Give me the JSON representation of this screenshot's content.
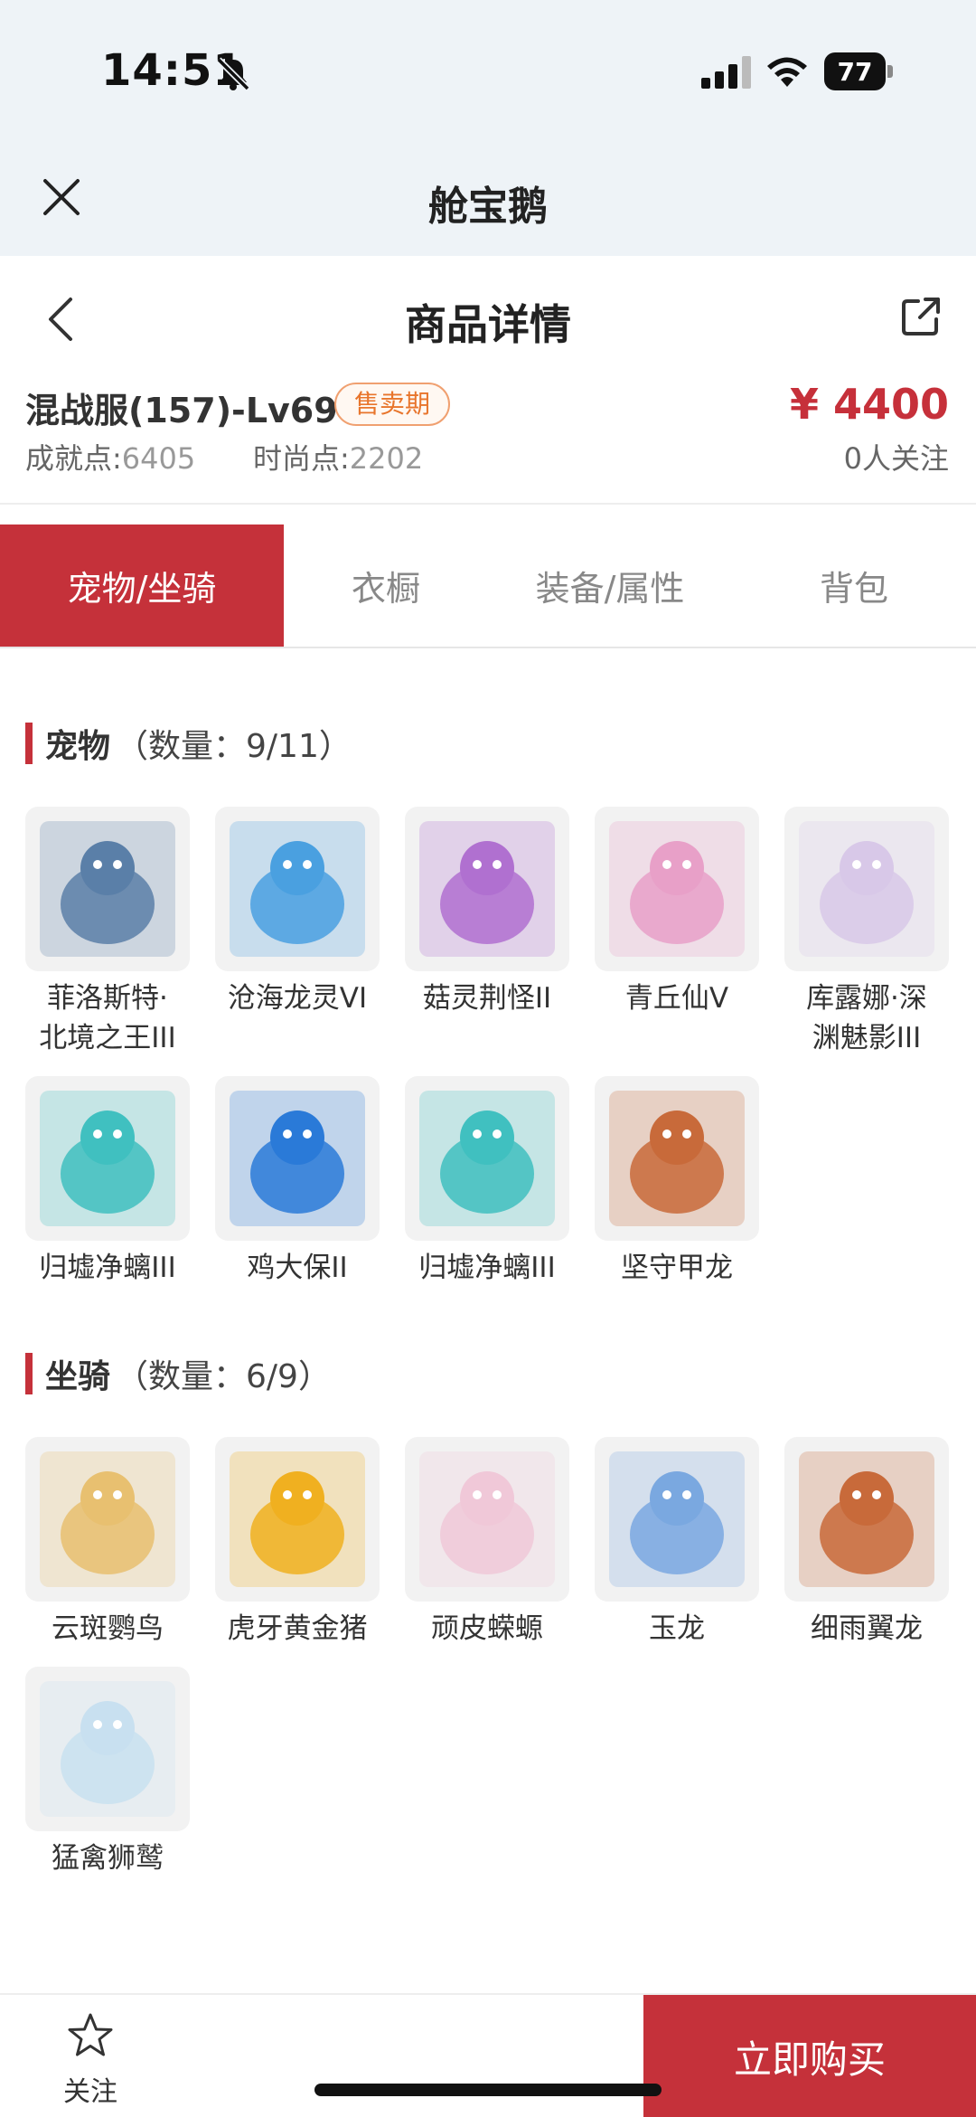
{
  "status_bar": {
    "time": "14:51",
    "battery": "77"
  },
  "app_bar": {
    "title": "舱宝鹅"
  },
  "header": {
    "title": "商品详情"
  },
  "product": {
    "name": "混战服(157)-Lv69",
    "status_badge": "售卖期",
    "price": "¥ 4400",
    "achievements_label": "成就点:",
    "achievements_value": "6405",
    "fashion_label": "时尚点:",
    "fashion_value": "2202",
    "followers": "0人关注"
  },
  "tabs": [
    {
      "label": "宠物/坐骑",
      "active": true
    },
    {
      "label": "衣橱",
      "active": false
    },
    {
      "label": "装备/属性",
      "active": false
    },
    {
      "label": "背包",
      "active": false
    }
  ],
  "pets": {
    "title": "宠物",
    "count": "（数量：9/11）",
    "items": [
      {
        "name": "菲洛斯特·北境之王III",
        "line1": "菲洛斯特·",
        "line2": "北境之王III",
        "icon": "white-wolf-king-icon",
        "color": "#5a7fa8"
      },
      {
        "name": "沧海龙灵VI",
        "line1": "沧海龙灵VI",
        "line2": "",
        "icon": "blue-dragon-spirit-icon",
        "color": "#4aa0e0"
      },
      {
        "name": "菇灵荆怪II",
        "line1": "菇灵荆怪II",
        "line2": "",
        "icon": "mushroom-sprite-icon",
        "color": "#b070d0"
      },
      {
        "name": "青丘仙V",
        "line1": "青丘仙V",
        "line2": "",
        "icon": "fox-fairy-icon",
        "color": "#e8a0c8"
      },
      {
        "name": "库露娜·深渊魅影III",
        "line1": "库露娜·深",
        "line2": "渊魅影III",
        "icon": "abyss-phantom-icon",
        "color": "#d8c8e8"
      },
      {
        "name": "归墟净螭III",
        "line1": "归墟净螭III",
        "line2": "",
        "icon": "water-dragon-icon",
        "color": "#40c0c0"
      },
      {
        "name": "鸡大保II",
        "line1": "鸡大保II",
        "line2": "",
        "icon": "blue-chicken-icon",
        "color": "#2a7ad8"
      },
      {
        "name": "归墟净螭III",
        "line1": "归墟净螭III",
        "line2": "",
        "icon": "water-dragon-icon",
        "color": "#40c0c0"
      },
      {
        "name": "坚守甲龙",
        "line1": "坚守甲龙",
        "line2": "",
        "icon": "armored-dragon-icon",
        "color": "#c86a3a"
      }
    ]
  },
  "mounts": {
    "title": "坐骑",
    "count": "（数量：6/9）",
    "items": [
      {
        "name": "云斑鹦鸟",
        "icon": "cloud-parrot-icon",
        "color": "#e8c070"
      },
      {
        "name": "虎牙黄金猪",
        "icon": "golden-pig-icon",
        "color": "#f0b020"
      },
      {
        "name": "顽皮蝾螈",
        "icon": "pink-axolotl-icon",
        "color": "#f0c8d8"
      },
      {
        "name": "玉龙",
        "icon": "jade-dragon-icon",
        "color": "#7aa8e0"
      },
      {
        "name": "细雨翼龙",
        "icon": "rain-pterosaur-icon",
        "color": "#c86a3a"
      },
      {
        "name": "猛禽狮鹫",
        "icon": "griffin-icon",
        "color": "#c8e0f0"
      }
    ]
  },
  "bottom_bar": {
    "follow_label": "关注",
    "buy_label": "立即购买"
  },
  "colors": {
    "accent": "#c5313a",
    "badge": "#e8752c"
  }
}
